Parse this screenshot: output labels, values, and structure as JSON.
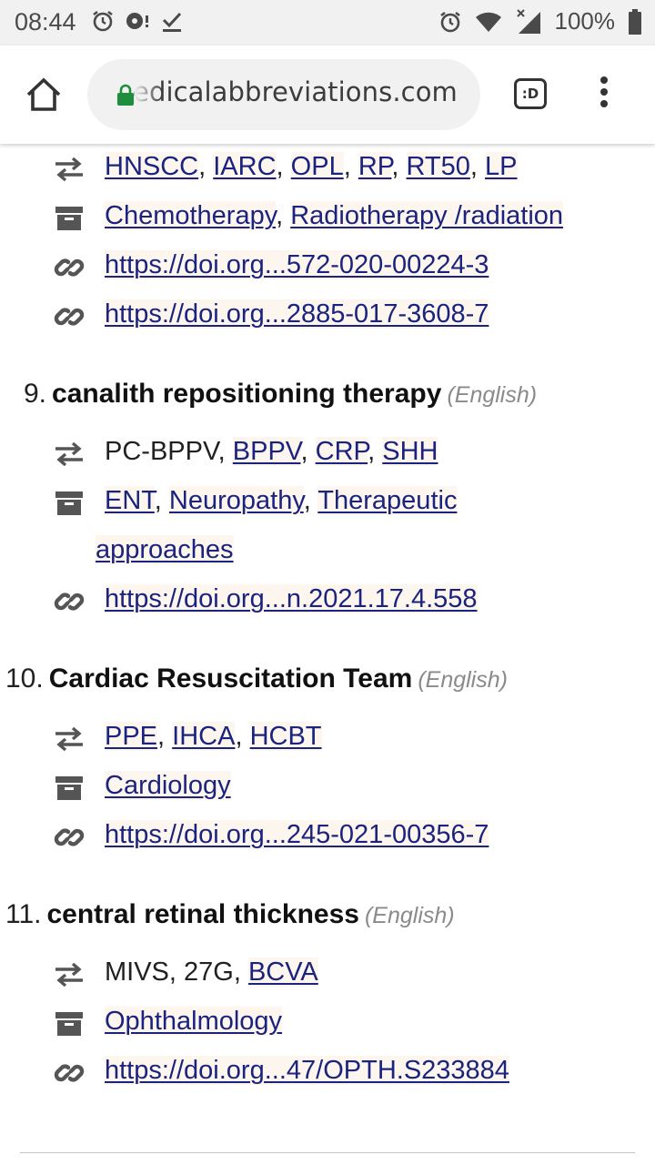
{
  "status_bar": {
    "time": "08:44",
    "battery": "100%"
  },
  "browser": {
    "url": "edicalabbreviations.com",
    "tab_label": ":D"
  },
  "entries": [
    {
      "id": "8",
      "abbrs_plain": "",
      "abbrs": [
        "HNSCC",
        "IARC",
        "OPL",
        "RP",
        "RT50",
        "LP"
      ],
      "categories": [
        "Chemotherapy",
        "Radiotherapy /radiation"
      ],
      "links": [
        "https://doi.org...572-020-00224-3",
        "https://doi.org...2885-017-3608-7"
      ]
    },
    {
      "number": "9.",
      "term": "canalith repositioning therapy",
      "language": "(English)",
      "abbrs_plain": "PC-BPPV",
      "abbrs": [
        "BPPV",
        "CRP",
        "SHH"
      ],
      "categories": [
        "ENT",
        "Neuropathy",
        "Therapeutic approaches"
      ],
      "links": [
        "https://doi.org...n.2021.17.4.558"
      ]
    },
    {
      "number": "10.",
      "term": "Cardiac Resuscitation Team",
      "language": "(English)",
      "abbrs_plain": "",
      "abbrs": [
        "PPE",
        "IHCA",
        "HCBT"
      ],
      "categories": [
        "Cardiology"
      ],
      "links": [
        "https://doi.org...245-021-00356-7"
      ]
    },
    {
      "number": "11.",
      "term": "central retinal thickness",
      "language": "(English)",
      "abbrs_plain": "MIVS, 27G",
      "abbrs": [
        "BCVA"
      ],
      "categories": [
        "Ophthalmology"
      ],
      "links": [
        "https://doi.org...47/OPTH.S233884"
      ]
    }
  ],
  "icons": {
    "synonyms": "swap-arrows-icon",
    "category": "archive-box-icon",
    "link": "link-icon"
  },
  "colors": {
    "link": "#1a237e",
    "link_bg": "#fdf6ef",
    "lock": "#1e8e3e"
  }
}
